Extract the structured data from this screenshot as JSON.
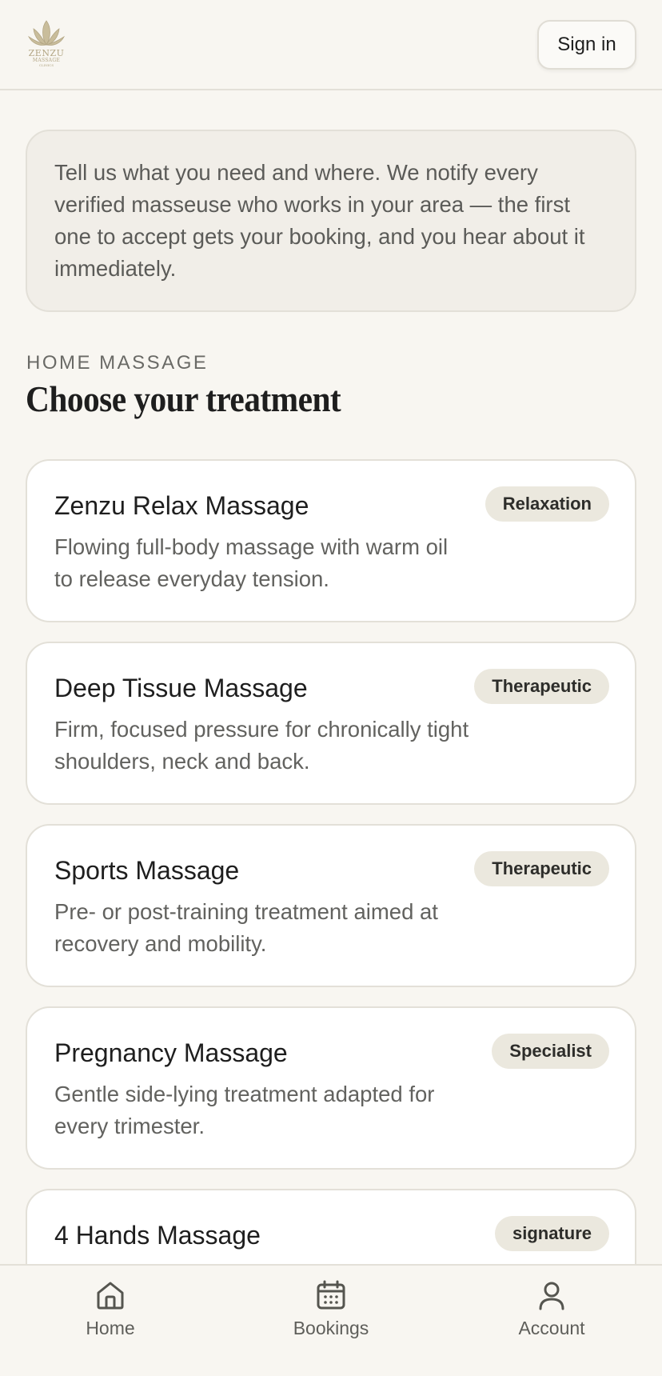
{
  "app": {
    "logo_name": "ZENZU",
    "logo_sub": "MASSAGE",
    "logo_sub2": "CLINICS"
  },
  "header": {
    "sign_in_label": "Sign in"
  },
  "intro": {
    "text": "Tell us what you need and where. We notify every verified masseuse who works in your area — the first one to accept gets your booking, and you hear about it immediately."
  },
  "section": {
    "eyebrow": "HOME MASSAGE",
    "title": "Choose your treatment"
  },
  "treatments": [
    {
      "title": "Zenzu Relax Massage",
      "badge": "Relaxation",
      "description": "Flowing full-body massage with warm oil to release everyday tension."
    },
    {
      "title": "Deep Tissue Massage",
      "badge": "Therapeutic",
      "description": "Firm, focused pressure for chronically tight shoulders, neck and back."
    },
    {
      "title": "Sports Massage",
      "badge": "Therapeutic",
      "description": "Pre- or post-training treatment aimed at recovery and mobility."
    },
    {
      "title": "Pregnancy Massage",
      "badge": "Specialist",
      "description": "Gentle side-lying treatment adapted for every trimester."
    },
    {
      "title": "4 Hands Massage",
      "badge": "signature",
      "description": ""
    }
  ],
  "tabbar": {
    "items": [
      {
        "label": "Home",
        "icon": "home-icon"
      },
      {
        "label": "Bookings",
        "icon": "calendar-icon"
      },
      {
        "label": "Account",
        "icon": "user-icon"
      }
    ]
  },
  "colors": {
    "background": "#f8f6f1",
    "card": "#ffffff",
    "badge": "#ebe8de",
    "logo_gold": "#b3a684"
  }
}
